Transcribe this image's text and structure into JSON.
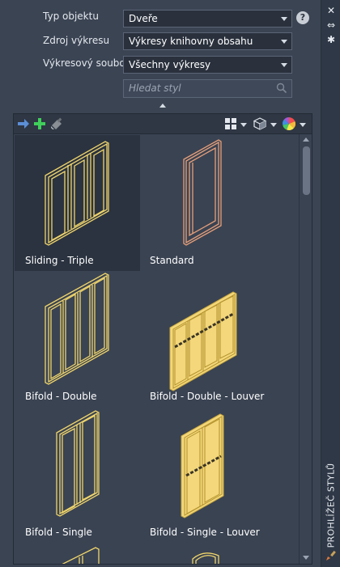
{
  "form": {
    "object_type": {
      "label": "Typ objektu",
      "value": "Dveře"
    },
    "drawing_source": {
      "label": "Zdroj výkresu",
      "value": "Výkresy knihovny obsahu"
    },
    "drawing_file": {
      "label": "Výkresový soubor",
      "value": "Všechny výkresy"
    },
    "search": {
      "placeholder": "Hledat styl"
    },
    "help_glyph": "?"
  },
  "toolbar": {
    "icons": [
      "arrow-right-icon",
      "add-icon",
      "purge-icon",
      "grid-view-icon",
      "3d-view-icon",
      "color-wheel-icon"
    ]
  },
  "styles": [
    {
      "label": "Sliding - Triple",
      "selected": true
    },
    {
      "label": "Standard"
    },
    {
      "label": "Bifold - Double"
    },
    {
      "label": "Bifold - Double - Louver"
    },
    {
      "label": "Bifold - Single"
    },
    {
      "label": "Bifold - Single - Louver"
    }
  ],
  "palette": {
    "panel_bg": "#3b4453",
    "toolbar_bg": "#2f3744",
    "selected_tile": "#2b3340",
    "door_outline": "#f0d56a",
    "door_fill": "#f3d77a",
    "standard_door": "#e8a07a",
    "add_green": "#3fcf5a",
    "arrow_blue": "#5b8fd6"
  },
  "titlebar": {
    "title": "PROHLÍŽEČ STYLŮ",
    "close_glyph": "✕",
    "pin_glyph": "⇔",
    "menu_glyph": "✱"
  }
}
